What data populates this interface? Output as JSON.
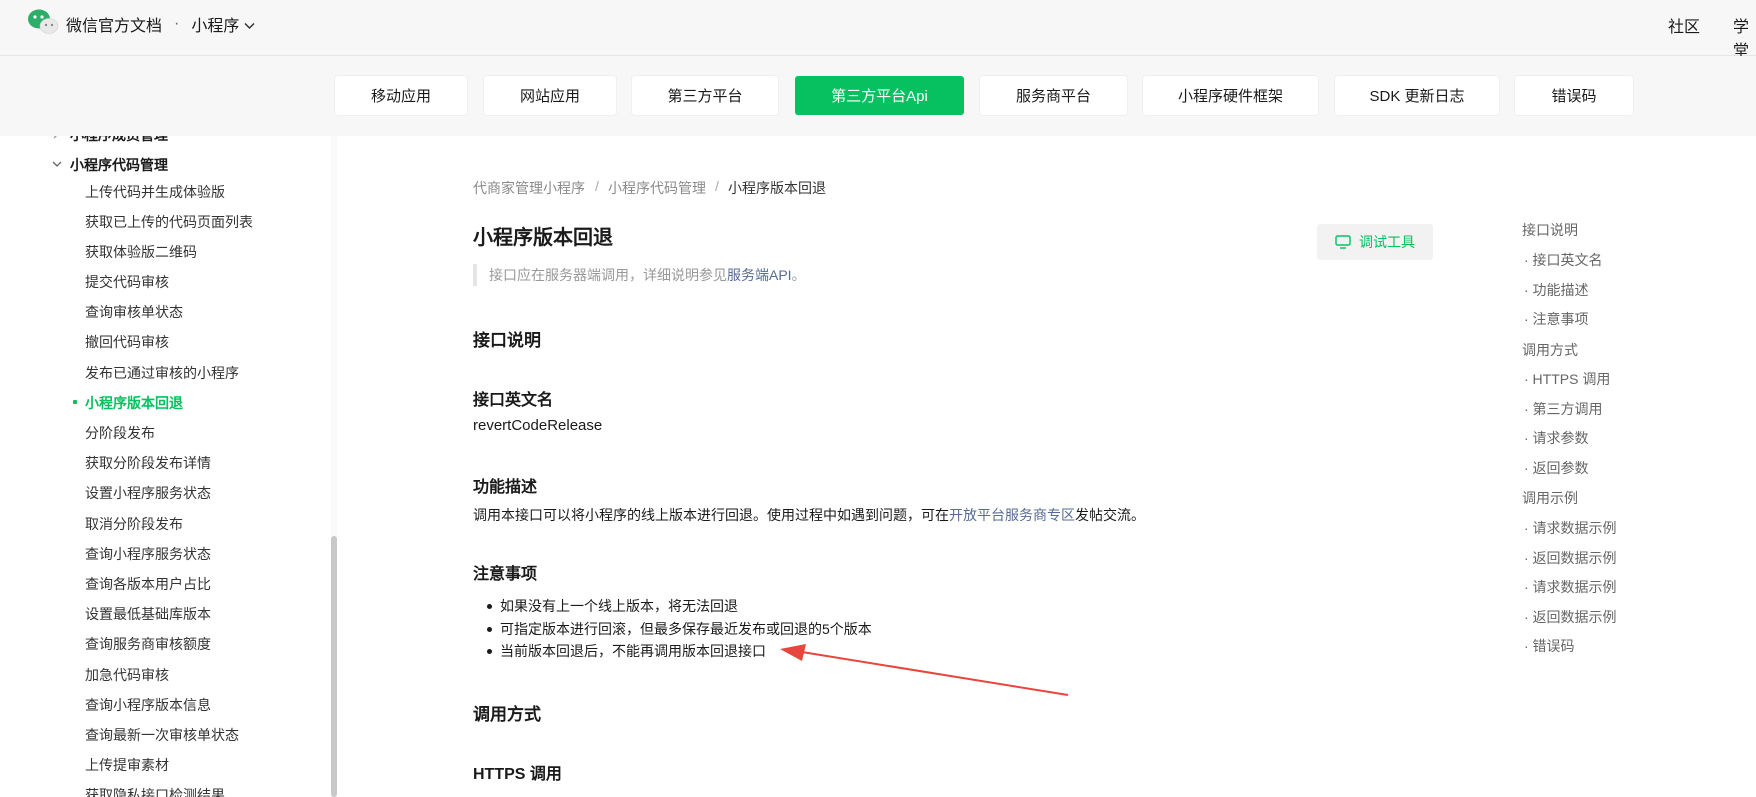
{
  "header": {
    "brand_title": "微信官方文档",
    "separator": "·",
    "section": "小程序",
    "right_links": [
      "社区",
      "学堂"
    ]
  },
  "categories": [
    {
      "label": "移动应用",
      "active": false
    },
    {
      "label": "网站应用",
      "active": false
    },
    {
      "label": "第三方平台",
      "active": false
    },
    {
      "label": "第三方平台Api",
      "active": true
    },
    {
      "label": "服务商平台",
      "active": false
    },
    {
      "label": "小程序硬件框架",
      "active": false
    },
    {
      "label": "SDK 更新日志",
      "active": false
    },
    {
      "label": "错误码",
      "active": false
    }
  ],
  "sidebar": {
    "groups": [
      {
        "label": "小程序成员管理",
        "expanded": false
      },
      {
        "label": "小程序代码管理",
        "expanded": true
      }
    ],
    "items": [
      "上传代码并生成体验版",
      "获取已上传的代码页面列表",
      "获取体验版二维码",
      "提交代码审核",
      "查询审核单状态",
      "撤回代码审核",
      "发布已通过审核的小程序",
      "小程序版本回退",
      "分阶段发布",
      "获取分阶段发布详情",
      "设置小程序服务状态",
      "取消分阶段发布",
      "查询小程序服务状态",
      "查询各版本用户占比",
      "设置最低基础库版本",
      "查询服务商审核额度",
      "加急代码审核",
      "查询小程序版本信息",
      "查询最新一次审核单状态",
      "上传提审素材",
      "获取隐私接口检测结果"
    ],
    "active_index": 7
  },
  "breadcrumb": {
    "items": [
      "代商家管理小程序",
      "小程序代码管理",
      "小程序版本回退"
    ],
    "separator": "/"
  },
  "main": {
    "title": "小程序版本回退",
    "debug_button": "调试工具",
    "notice_prefix": "接口应在服务器端调用，详细说明参见",
    "notice_link": "服务端API",
    "notice_suffix": "。",
    "section_api_desc": "接口说明",
    "h_english_name": "接口英文名",
    "english_name": "revertCodeRelease",
    "h_function": "功能描述",
    "function_prefix": "调用本接口可以将小程序的线上版本进行回退。使用过程中如遇到问题，可在",
    "function_link": "开放平台服务商专区",
    "function_suffix": "发帖交流。",
    "h_notes": "注意事项",
    "notes": [
      "如果没有上一个线上版本，将无法回退",
      "可指定版本进行回滚，但最多保存最近发布或回退的5个版本",
      "当前版本回退后，不能再调用版本回退接口"
    ],
    "section_call": "调用方式",
    "h_https": "HTTPS 调用"
  },
  "toc": [
    {
      "label": "接口说明",
      "level": 1
    },
    {
      "label": "· 接口英文名",
      "level": 2
    },
    {
      "label": "· 功能描述",
      "level": 2
    },
    {
      "label": "· 注意事项",
      "level": 2
    },
    {
      "label": "调用方式",
      "level": 1
    },
    {
      "label": "· HTTPS 调用",
      "level": 2
    },
    {
      "label": "· 第三方调用",
      "level": 2
    },
    {
      "label": "· 请求参数",
      "level": 2
    },
    {
      "label": "· 返回参数",
      "level": 2
    },
    {
      "label": "调用示例",
      "level": 1
    },
    {
      "label": "· 请求数据示例",
      "level": 2
    },
    {
      "label": "· 返回数据示例",
      "level": 2
    },
    {
      "label": "· 请求数据示例",
      "level": 2
    },
    {
      "label": "· 返回数据示例",
      "level": 2
    },
    {
      "label": "· 错误码",
      "level": 2
    }
  ],
  "colors": {
    "accent": "#07c160",
    "link": "#576b95",
    "annotation_arrow": "#e8453c"
  }
}
